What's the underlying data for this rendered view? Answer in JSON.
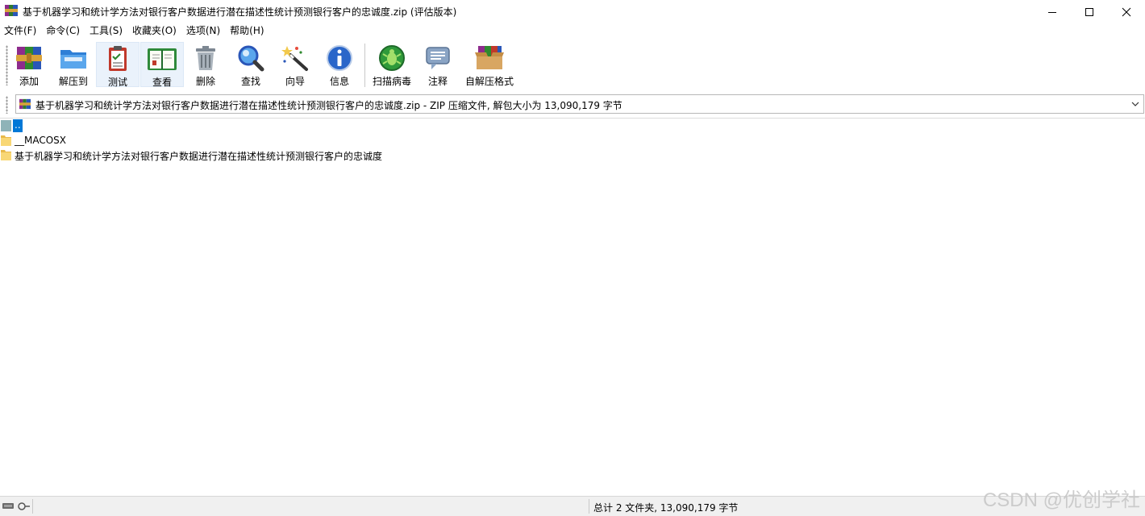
{
  "window": {
    "title": "基于机器学习和统计学方法对银行客户数据进行潜在描述性统计预测银行客户的忠诚度.zip (评估版本)"
  },
  "menu": [
    {
      "label": "文件(F)"
    },
    {
      "label": "命令(C)"
    },
    {
      "label": "工具(S)"
    },
    {
      "label": "收藏夹(O)"
    },
    {
      "label": "选项(N)"
    },
    {
      "label": "帮助(H)"
    }
  ],
  "toolbar": {
    "buttons": [
      {
        "label": "添加",
        "icon": "archive-books-icon"
      },
      {
        "label": "解压到",
        "icon": "folder-extract-icon"
      },
      {
        "label": "测试",
        "icon": "clipboard-check-icon"
      },
      {
        "label": "查看",
        "icon": "open-book-icon"
      },
      {
        "label": "删除",
        "icon": "trash-can-icon"
      },
      {
        "label": "查找",
        "icon": "magnifier-icon"
      },
      {
        "label": "向导",
        "icon": "magic-wand-icon"
      },
      {
        "label": "信息",
        "icon": "info-icon"
      },
      {
        "label": "扫描病毒",
        "icon": "virus-scan-icon"
      },
      {
        "label": "注释",
        "icon": "comment-icon"
      },
      {
        "label": "自解压格式",
        "icon": "sfx-box-icon"
      }
    ]
  },
  "address": {
    "path": "基于机器学习和统计学方法对银行客户数据进行潜在描述性统计预测银行客户的忠诚度.zip - ZIP 压缩文件, 解包大小为 13,090,179 字节"
  },
  "files": [
    {
      "name": ".."
    },
    {
      "name": "__MACOSX"
    },
    {
      "name": "基于机器学习和统计学方法对银行客户数据进行潜在描述性统计预测银行客户的忠诚度"
    }
  ],
  "status": {
    "summary": "总计 2 文件夹, 13,090,179 字节",
    "watermark": "CSDN @优创学社"
  },
  "colors": {
    "selection": "#0078d7",
    "folder": "#f8d775"
  }
}
